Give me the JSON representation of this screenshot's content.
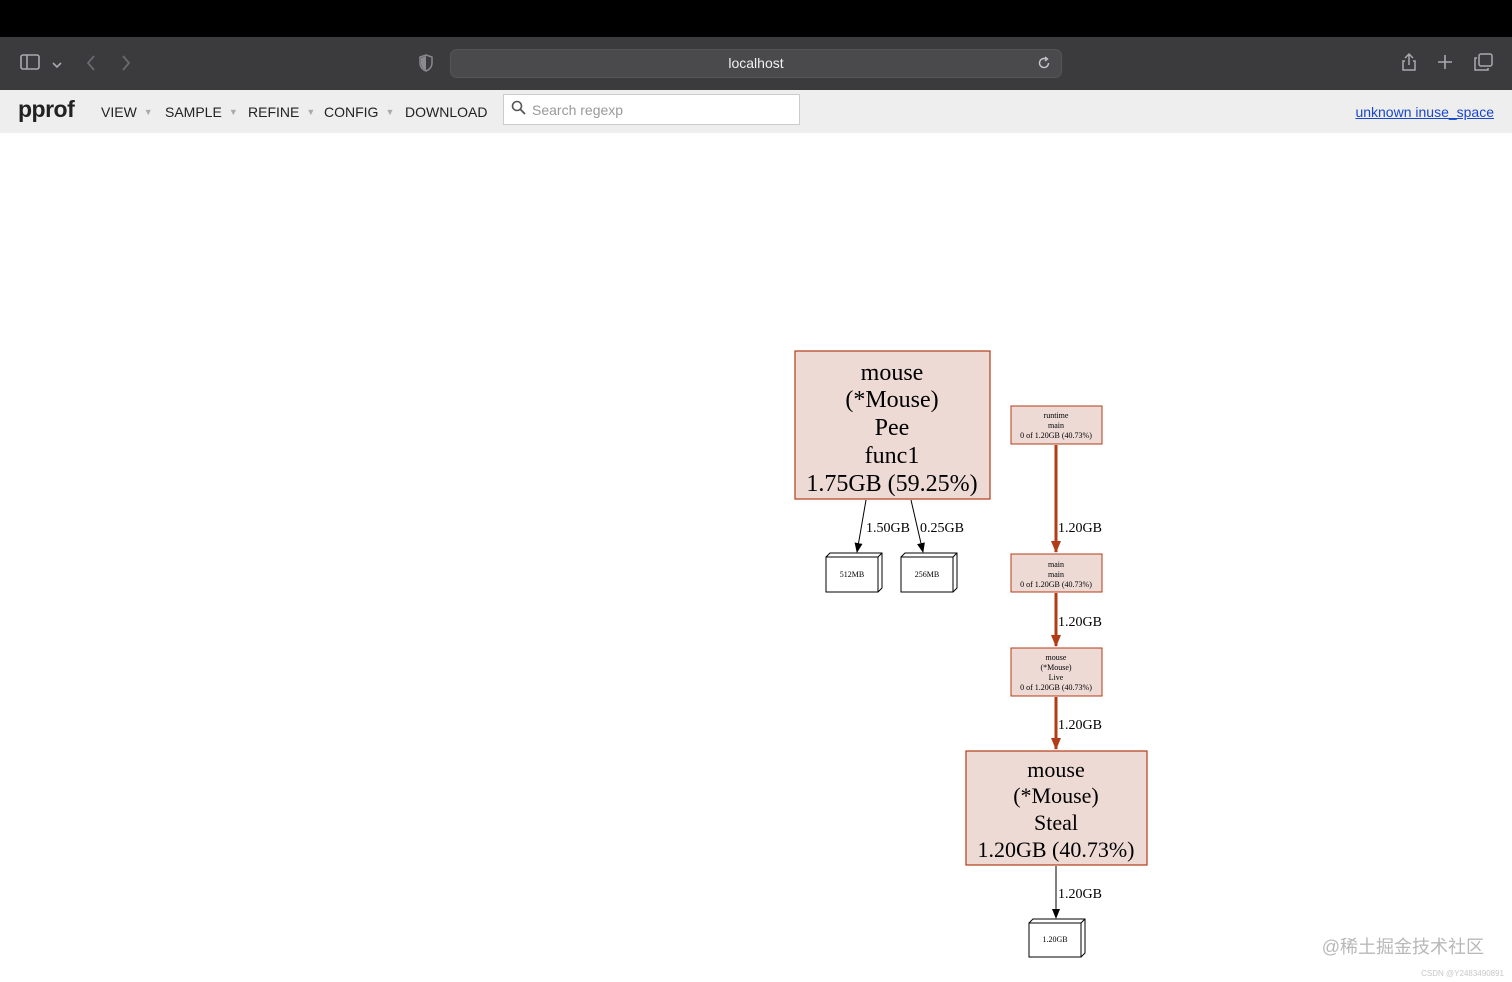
{
  "browser": {
    "url": "localhost",
    "icons": [
      "sidebar-icon",
      "chevron-down-icon",
      "back-icon",
      "forward-icon",
      "shield-icon",
      "reload-icon",
      "share-icon",
      "new-tab-icon",
      "tabs-overview-icon"
    ]
  },
  "pprof": {
    "logo": "pprof",
    "menu": [
      "VIEW",
      "SAMPLE",
      "REFINE",
      "CONFIG",
      "DOWNLOAD"
    ],
    "search_placeholder": "Search regexp",
    "legend_link": "unknown inuse_space"
  },
  "graph": {
    "nodes": {
      "pee": [
        "mouse",
        "(*Mouse)",
        "Pee",
        "func1",
        "1.75GB (59.25%)"
      ],
      "runtime_main": [
        "runtime",
        "main",
        "0 of 1.20GB (40.73%)"
      ],
      "main_main": [
        "main",
        "main",
        "0 of 1.20GB (40.73%)"
      ],
      "live": [
        "mouse",
        "(*Mouse)",
        "Live",
        "0 of 1.20GB (40.73%)"
      ],
      "steal": [
        "mouse",
        "(*Mouse)",
        "Steal",
        "1.20GB (40.73%)"
      ]
    },
    "alloc_boxes": {
      "b512": "512MB",
      "b256": "256MB",
      "b120": "1.20GB"
    },
    "edges": {
      "pee_512": "1.50GB",
      "pee_256": "0.25GB",
      "runtime_main": "1.20GB",
      "main_live": "1.20GB",
      "live_steal": "1.20GB",
      "steal_box": "1.20GB"
    },
    "colors": {
      "node_fill": "#eddad5",
      "node_border": "#b23c17",
      "edge_hot": "#b23c17"
    }
  },
  "watermark": "@稀土掘金技术社区",
  "footer_mark": "CSDN @Y2483490891"
}
